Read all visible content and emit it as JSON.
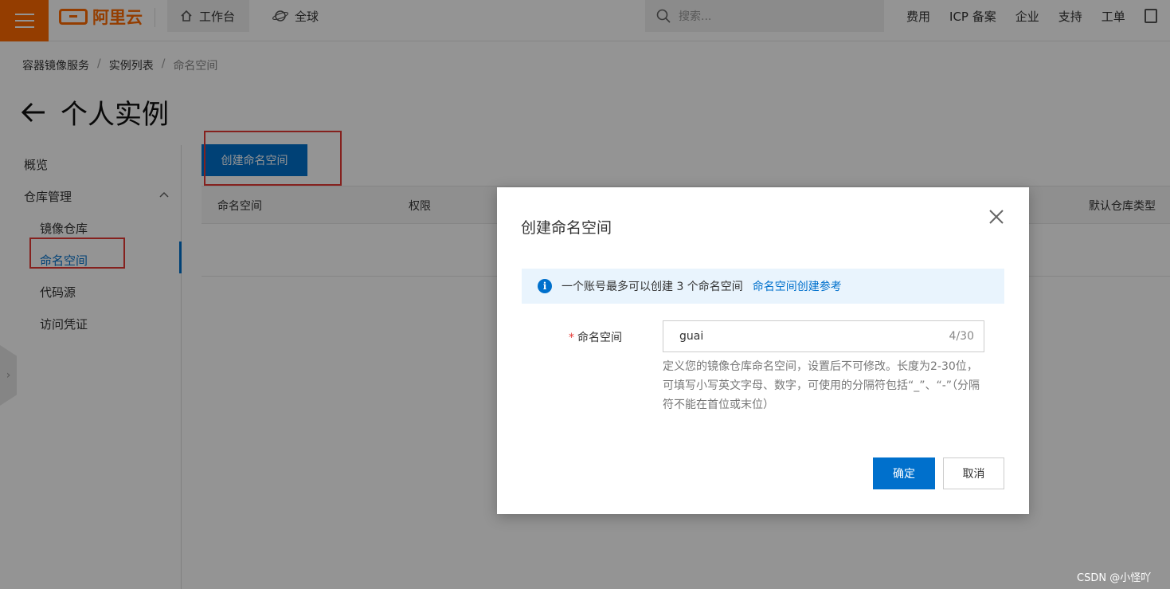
{
  "topbar": {
    "brand": "阿里云",
    "workbench": "工作台",
    "region": "全球",
    "search_placeholder": "搜索...",
    "nav": [
      "费用",
      "ICP 备案",
      "企业",
      "支持",
      "工单"
    ]
  },
  "breadcrumb": [
    "容器镜像服务",
    "实例列表",
    "命名空间"
  ],
  "page": {
    "title": "个人实例"
  },
  "sidebar": {
    "overview": "概览",
    "repo_mgmt": "仓库管理",
    "items": [
      "镜像仓库",
      "命名空间",
      "代码源",
      "访问凭证"
    ]
  },
  "main": {
    "create_button": "创建命名空间",
    "columns": [
      "命名空间",
      "权限",
      "默认仓库类型"
    ]
  },
  "modal": {
    "title": "创建命名空间",
    "info_text": "一个账号最多可以创建 3 个命名空间",
    "info_link": "命名空间创建参考",
    "field_label": "命名空间",
    "field_value": "guai",
    "counter": "4/30",
    "help_text": "定义您的镜像仓库命名空间，设置后不可修改。长度为2-30位，可填写小写英文字母、数字，可使用的分隔符包括“_”、“-”（分隔符不能在首位或末位）",
    "ok": "确定",
    "cancel": "取消"
  },
  "watermark": "CSDN @小怪吖"
}
